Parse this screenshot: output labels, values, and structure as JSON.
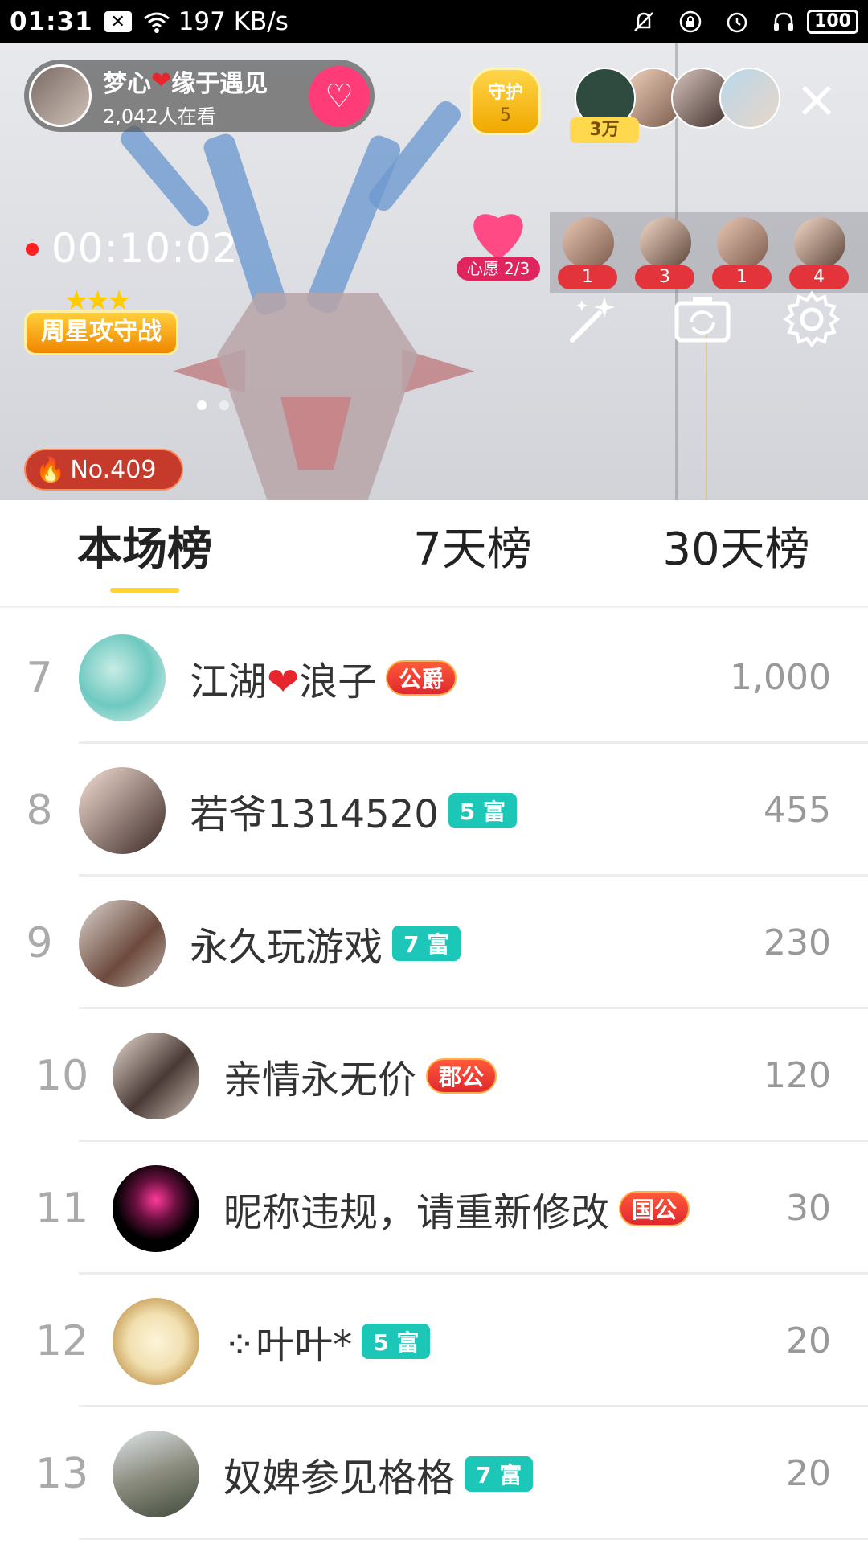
{
  "status_bar": {
    "time": "01:31",
    "speed": "197 KB/s",
    "battery": "100",
    "icons": [
      "notification-x-icon",
      "wifi-icon",
      "bell-off-icon",
      "lock-rotation-icon",
      "alarm-icon",
      "headphones-icon",
      "battery-icon"
    ]
  },
  "live": {
    "anchor_name_part1": "梦心",
    "anchor_name_heart": "❤",
    "anchor_name_part2": "缘于遇见",
    "viewers": "2,042人在看",
    "guard_title": "守护",
    "guard_count": "5",
    "top_viewer_badge": "3万",
    "timer": "00:10:02",
    "wish_label": "心愿 2/3",
    "gift_counts": [
      "1",
      "3",
      "1",
      "4"
    ],
    "weekstar_label": "周星攻守战",
    "hot_rank": "No.409"
  },
  "tabs": [
    {
      "label": "本场榜",
      "active": true
    },
    {
      "label": "7天榜",
      "active": false
    },
    {
      "label": "30天榜",
      "active": false
    }
  ],
  "ranking": [
    {
      "rank": "7",
      "name_a": "江湖",
      "name_heart": "❤",
      "name_b": "浪子",
      "badge": "公爵",
      "badge_type": "noble",
      "score": "1,000"
    },
    {
      "rank": "8",
      "name": "若爷1314520",
      "badge": "5 富",
      "badge_type": "rich",
      "score": "455"
    },
    {
      "rank": "9",
      "name": "永久玩游戏",
      "badge": "7 富",
      "badge_type": "rich",
      "score": "230"
    },
    {
      "rank": "10",
      "name": "亲情永无价",
      "badge": "郡公",
      "badge_type": "noble",
      "score": "120"
    },
    {
      "rank": "11",
      "name": "昵称违规，请重新修改",
      "badge": "国公",
      "badge_type": "noble",
      "score": "30"
    },
    {
      "rank": "12",
      "name": "⁘叶叶*",
      "badge": "5 富",
      "badge_type": "rich",
      "score": "20"
    },
    {
      "rank": "13",
      "name": "奴婢参见格格",
      "badge": "7 富",
      "badge_type": "rich",
      "score": "20"
    }
  ]
}
